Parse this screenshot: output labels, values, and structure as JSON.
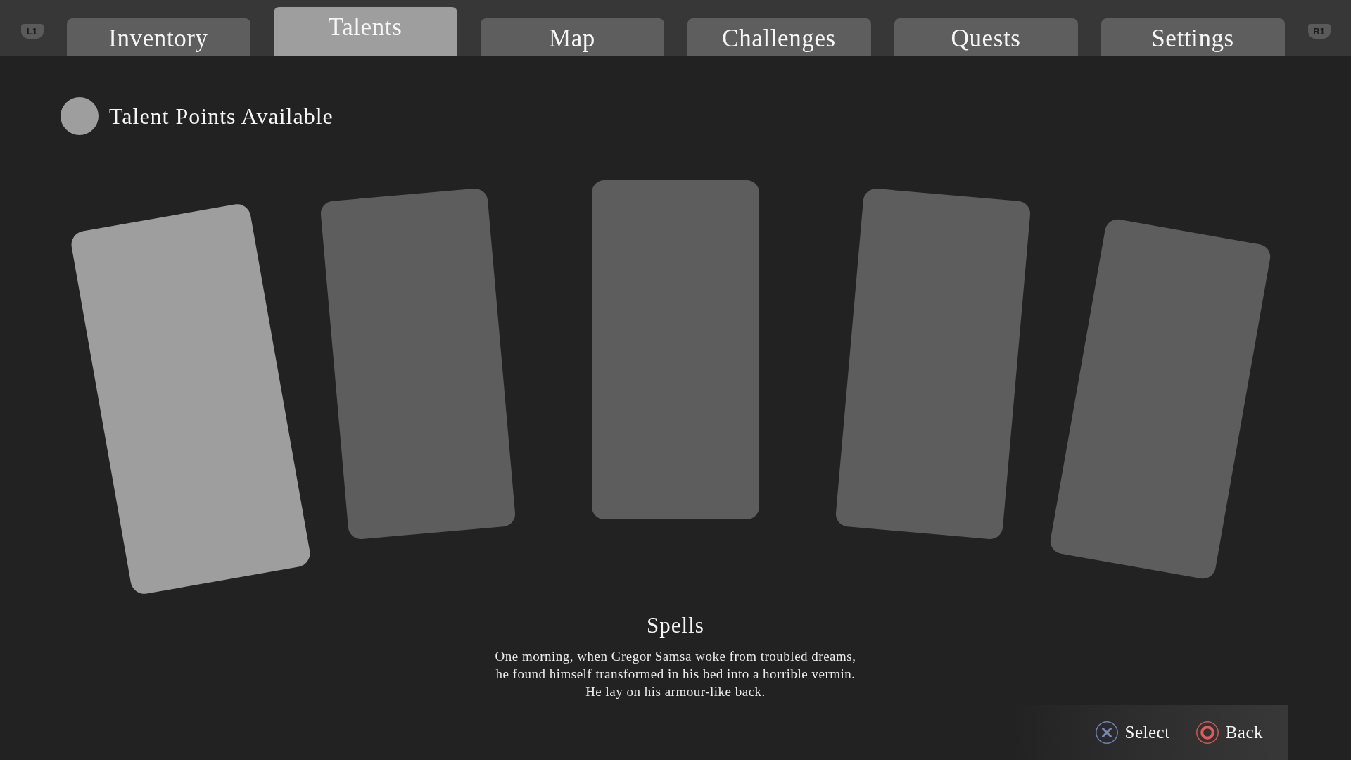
{
  "tab_bar": {
    "prev_key": "L1",
    "next_key": "R1",
    "tabs": [
      {
        "label": "Inventory",
        "selected": false
      },
      {
        "label": "Talents",
        "selected": true
      },
      {
        "label": "Map",
        "selected": false
      },
      {
        "label": "Challenges",
        "selected": false
      },
      {
        "label": "Quests",
        "selected": false
      },
      {
        "label": "Settings",
        "selected": false
      }
    ]
  },
  "talent_points": {
    "label": "Talent Points Available"
  },
  "cards": [
    {
      "selected": true
    },
    {
      "selected": false
    },
    {
      "selected": false
    },
    {
      "selected": false
    },
    {
      "selected": false
    }
  ],
  "detail": {
    "title": "Spells",
    "description": "One morning, when Gregor Samsa woke from troubled dreams,\nhe found himself transformed in his bed into a horrible vermin.\nHe lay on his armour-like back."
  },
  "prompts": [
    {
      "kind": "cross",
      "label": "Select"
    },
    {
      "kind": "circle",
      "label": "Back"
    }
  ]
}
